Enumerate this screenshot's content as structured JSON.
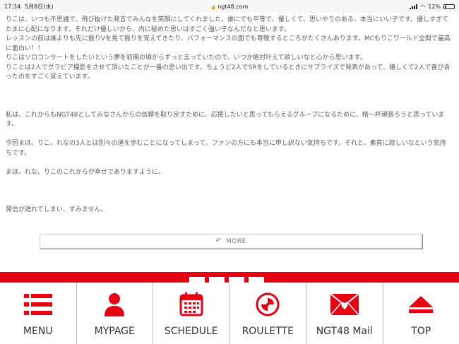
{
  "status_bar": {
    "time": "17:34",
    "date": "5月8日(水)",
    "url": "ngt48.com",
    "battery": "12%"
  },
  "article": {
    "paragraphs": [
      "りこは、いつも不思議で、飛び抜けた発言でみんなを笑顔にしてくれました。誰にでも平等で、優しくて、思いやりのある、本当にいい子です。優しすぎてたまに心配になります。それだけ優しいから、内に秘めた思いはすごく強い子なんだなと思います。",
      "レッスンの前は誰よりも先に振りVを見て振りを覚えてきたり、パフォーマンスの面でも尊敬するところがたくさんあります。MCもりこワールド全開で最高に面白い！！",
      "りこはソロコンサートをしたいという夢を初期の頃からずっと言っていたので、いつか絶対叶えて欲しいなと心から思います。",
      "りことは2人でグラビア撮影をさせて頂いたことが一番の思い出です。ちょうど2人でSRをしているときにサプライズで発表があって、嬉しくて2人で喜び合ったのをすごく覚えています。",
      "私は、これからもNGT48としてみなさんからの信頼を取り戻すために、応援したいと思ってもらえるグループになるために、精一杯頑張ろうと思っています。",
      "今回まほ、りこ、れなの3人とは別々の道を歩むことになってしまって、ファンの方にも本当に申し訳ない気持ちです。それと、素直に寂しいなという気持ちです。",
      "まほ、れな、りこのこれからが幸せでありますように。",
      "発信が遅れてしまい、すみません。"
    ]
  },
  "more_button": {
    "label": "MORE"
  },
  "footer_nav": {
    "accent_color": "#e50012",
    "items": [
      {
        "label": "MENU",
        "icon": "menu-list-icon"
      },
      {
        "label": "MYPAGE",
        "icon": "person-icon"
      },
      {
        "label": "SCHEDULE",
        "icon": "calendar-icon"
      },
      {
        "label": "ROULETTE",
        "icon": "roulette-icon"
      },
      {
        "label": "NGT48 Mail",
        "icon": "mail-heart-icon"
      },
      {
        "label": "TOP",
        "icon": "arrow-up-icon"
      }
    ]
  }
}
